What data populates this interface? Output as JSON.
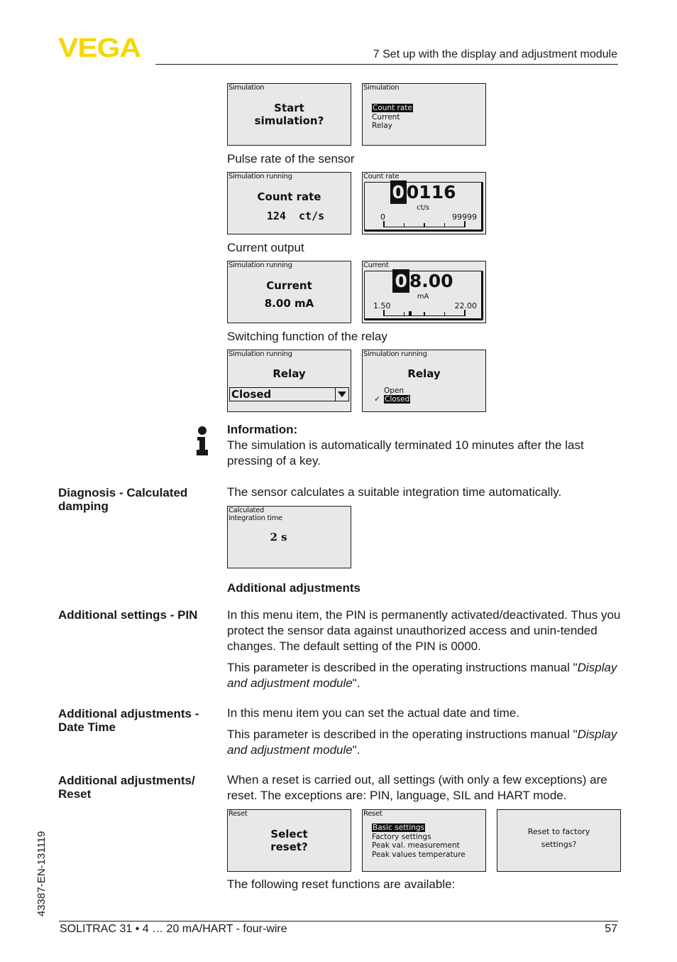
{
  "header": {
    "logo": "VEGA",
    "logo_color": "#f5d800",
    "section_title": "7 Set up with the display and adjustment module"
  },
  "side_code": "43387-EN-131119",
  "footer": {
    "product": "SOLITRAC 31 • 4 … 20 mA/HART - four-wire",
    "page_number": "57"
  },
  "simulation": {
    "screen_start": {
      "title": "Simulation",
      "line1": "Start",
      "line2": "simulation?"
    },
    "screen_menu": {
      "title": "Simulation",
      "items": [
        "Count rate",
        "Current",
        "Relay"
      ],
      "selected": "Count rate"
    },
    "caption_pulse": "Pulse rate of the sensor",
    "screen_count_running": {
      "title": "Simulation running",
      "label": "Count rate",
      "value": "124  ct/s"
    },
    "screen_count_gauge": {
      "title": "Count rate",
      "cursor_digit": "0",
      "value_rest": "0116",
      "unit": "ct/s",
      "min": "0",
      "max": "99999",
      "pointer_fraction": 0.001
    },
    "caption_current": "Current output",
    "screen_current_running": {
      "title": "Simulation running",
      "label": "Current",
      "value": "8.00 mA"
    },
    "screen_current_gauge": {
      "title": "Current",
      "cursor_digit": "0",
      "value_rest": "8.00",
      "unit": "mA",
      "min": "1.50",
      "max": "22.00",
      "pointer_fraction": 0.317
    },
    "caption_relay": "Switching function of the relay",
    "screen_relay_dropdown": {
      "title": "Simulation running",
      "label": "Relay",
      "selected": "Closed"
    },
    "screen_relay_options": {
      "title": "Simulation running",
      "label": "Relay",
      "options": [
        "Open",
        "Closed"
      ],
      "selected": "Closed",
      "check_glyph": "✓"
    }
  },
  "info_note": {
    "icon": "info-icon",
    "heading": "Information:",
    "text": "The simulation is automatically terminated 10 minutes after the last pressing of a key."
  },
  "damping": {
    "side_heading_line1": "Diagnosis - Calculated",
    "side_heading_line2": "damping",
    "text": "The sensor calculates a suitable integration time automatically.",
    "screen": {
      "title_line1": "Calculated",
      "title_line2": "integration time",
      "value": "2 s"
    }
  },
  "additional": {
    "heading": "Additional adjustments",
    "pin": {
      "side_heading": "Additional settings - PIN",
      "text1": "In this menu item, the PIN is permanently activated/deactivated. Thus you protect the sensor data against unauthorized access and unin-tended changes. The default setting of the PIN is 0000.",
      "text2_prefix": "This parameter is described in the operating instructions manual \"",
      "text2_italic": "Display and adjustment module",
      "text2_suffix": "\"."
    },
    "datetime": {
      "side_heading_line1": "Additional adjustments -",
      "side_heading_line2": "Date Time",
      "text1": "In this menu item you can set the actual date and time.",
      "text2_prefix": "This parameter is described in the operating instructions manual \"",
      "text2_italic": "Display and adjustment module",
      "text2_suffix": "\"."
    },
    "reset": {
      "side_heading_line1": "Additional adjustments/",
      "side_heading_line2": "Reset",
      "text": "When a reset is carried out, all settings (with only a few exceptions) are reset. The exceptions are: PIN, language, SIL and HART mode.",
      "screen_select": {
        "title": "Reset",
        "line1": "Select",
        "line2": "reset?"
      },
      "screen_menu": {
        "title": "Reset",
        "items": [
          "Basic settings",
          "Factory settings",
          "Peak val. measurement",
          "Peak values temperature"
        ],
        "selected": "Basic settings"
      },
      "screen_confirm": {
        "line1": "Reset to factory",
        "line2": "settings?"
      },
      "caption": "The following reset functions are available:"
    }
  }
}
